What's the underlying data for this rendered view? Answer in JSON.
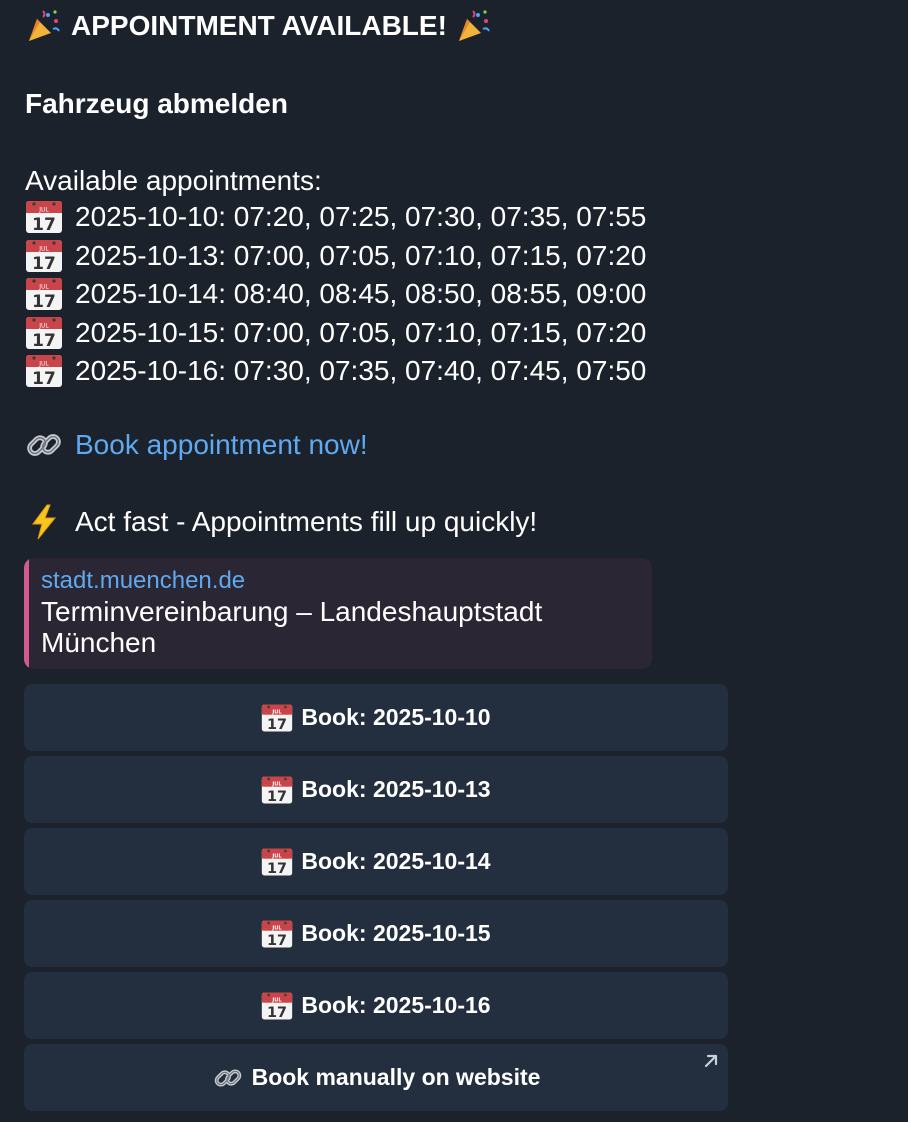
{
  "message": {
    "title": "APPOINTMENT AVAILABLE!",
    "service": "Fahrzeug abmelden",
    "available_label": "Available appointments:",
    "appointments": [
      {
        "text": "2025-10-10: 07:20, 07:25, 07:30, 07:35, 07:55"
      },
      {
        "text": "2025-10-13: 07:00, 07:05, 07:10, 07:15, 07:20"
      },
      {
        "text": "2025-10-14: 08:40, 08:45, 08:50, 08:55, 09:00"
      },
      {
        "text": "2025-10-15: 07:00, 07:05, 07:10, 07:15, 07:20"
      },
      {
        "text": "2025-10-16: 07:30, 07:35, 07:40, 07:45, 07:50"
      }
    ],
    "calendar_icon": "calendar-icon",
    "calendar_icon_month": "JUL",
    "calendar_icon_day": "17",
    "link_text": "Book appointment now!",
    "urgency_text": "Act fast - Appointments fill up quickly!"
  },
  "link_preview": {
    "domain": "stadt.muenchen.de",
    "title": "Terminvereinbarung – Landeshauptstadt München",
    "accent_color": "#d25a8e"
  },
  "keyboard": {
    "buttons": [
      {
        "label": "Book: 2025-10-10",
        "icon": "calendar-icon"
      },
      {
        "label": "Book: 2025-10-13",
        "icon": "calendar-icon"
      },
      {
        "label": "Book: 2025-10-14",
        "icon": "calendar-icon"
      },
      {
        "label": "Book: 2025-10-15",
        "icon": "calendar-icon"
      },
      {
        "label": "Book: 2025-10-16",
        "icon": "calendar-icon"
      }
    ],
    "manual_button": {
      "label": "Book manually on website",
      "icon": "link-icon",
      "external": true
    }
  },
  "colors": {
    "background": "#1b222c",
    "link": "#5fa9f0",
    "button_bg": "#232f3e"
  }
}
